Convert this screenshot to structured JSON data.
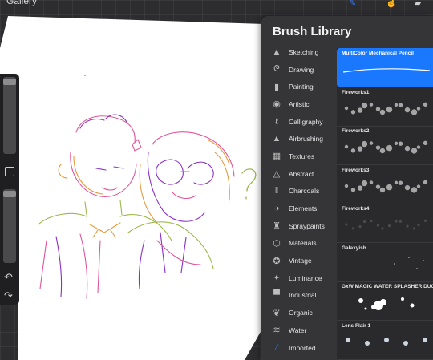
{
  "top_toolbar": {
    "gallery_label": "Gallery",
    "tools": [
      {
        "icon": "brush-icon",
        "glyph": "✎"
      },
      {
        "icon": "smudge-icon",
        "glyph": "☝"
      },
      {
        "icon": "eraser-icon",
        "glyph": "▰"
      }
    ]
  },
  "canvas": {
    "question_mark": "?"
  },
  "sidebar": {
    "modify_icon": "square-icon",
    "undo_glyph": "↶",
    "redo_glyph": "↷"
  },
  "brush_library": {
    "title": "Brush Library",
    "categories": [
      {
        "label": "Sketching",
        "icon": "pencil-tip-icon",
        "glyph": "▲"
      },
      {
        "label": "Drawing",
        "icon": "swirl-icon",
        "glyph": "ᘓ"
      },
      {
        "label": "Painting",
        "icon": "paint-brush-icon",
        "glyph": "▮"
      },
      {
        "label": "Artistic",
        "icon": "palette-icon",
        "glyph": "◉"
      },
      {
        "label": "Calligraphy",
        "icon": "calligraphy-icon",
        "glyph": "ℓ"
      },
      {
        "label": "Airbrushing",
        "icon": "airbrush-icon",
        "glyph": "▲"
      },
      {
        "label": "Textures",
        "icon": "texture-icon",
        "glyph": "▦"
      },
      {
        "label": "Abstract",
        "icon": "triangle-icon",
        "glyph": "△"
      },
      {
        "label": "Charcoals",
        "icon": "charcoal-icon",
        "glyph": "‖"
      },
      {
        "label": "Elements",
        "icon": "yin-yang-icon",
        "glyph": "◑"
      },
      {
        "label": "Spraypaints",
        "icon": "spray-can-icon",
        "glyph": "♜"
      },
      {
        "label": "Materials",
        "icon": "cube-icon",
        "glyph": "⬡"
      },
      {
        "label": "Vintage",
        "icon": "star-badge-icon",
        "glyph": "✪"
      },
      {
        "label": "Luminance",
        "icon": "sparkle-icon",
        "glyph": "✦"
      },
      {
        "label": "Industrial",
        "icon": "anvil-icon",
        "glyph": "▀"
      },
      {
        "label": "Organic",
        "icon": "leaf-icon",
        "glyph": "❦"
      },
      {
        "label": "Water",
        "icon": "waves-icon",
        "glyph": "≋"
      },
      {
        "label": "Imported",
        "icon": "imported-brush-icon",
        "glyph": "⁄"
      }
    ],
    "selected_category_index": 17,
    "brushes": [
      {
        "name": "MultiColor Mechanical Pencil",
        "stroke": "pencil",
        "selected": true
      },
      {
        "name": "Fireworks1",
        "stroke": "sparkle"
      },
      {
        "name": "Fireworks2",
        "stroke": "sparkle"
      },
      {
        "name": "Fireworks3",
        "stroke": "sparkle"
      },
      {
        "name": "Fireworks4",
        "stroke": "faint"
      },
      {
        "name": "Galaxyish",
        "stroke": "dots"
      },
      {
        "name": "GxW MAGIC WATER SPLASHER DUO COLOR",
        "stroke": "splash"
      },
      {
        "name": "Lens Flair  1",
        "stroke": "flare"
      }
    ]
  },
  "colors": {
    "accent": "#1a78ff",
    "panel": "#353538",
    "canvas_paper": "#ffffff",
    "sketch_pink": "#e0559a",
    "sketch_purple": "#8a2fc4",
    "sketch_green": "#9bb84a",
    "sketch_orange": "#e69a3a"
  }
}
